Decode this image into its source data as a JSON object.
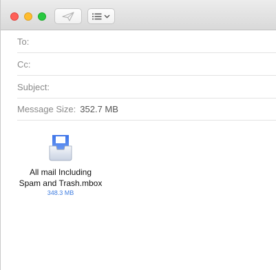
{
  "toolbar": {
    "send_icon": "paper-plane-icon",
    "format_icon": "list-format-icon"
  },
  "headers": {
    "to_label": "To:",
    "cc_label": "Cc:",
    "subject_label": "Subject:",
    "size_label": "Message Size:",
    "size_value": "352.7 MB"
  },
  "attachment": {
    "name_line1": "All mail Including",
    "name_line2": "Spam and Trash.mbox",
    "size": "348.3 MB",
    "icon": "mailbox-file-icon"
  },
  "colors": {
    "close": "#fe5f57",
    "minimize": "#febc2e",
    "maximize": "#28c840",
    "size_link": "#3f7de0"
  }
}
